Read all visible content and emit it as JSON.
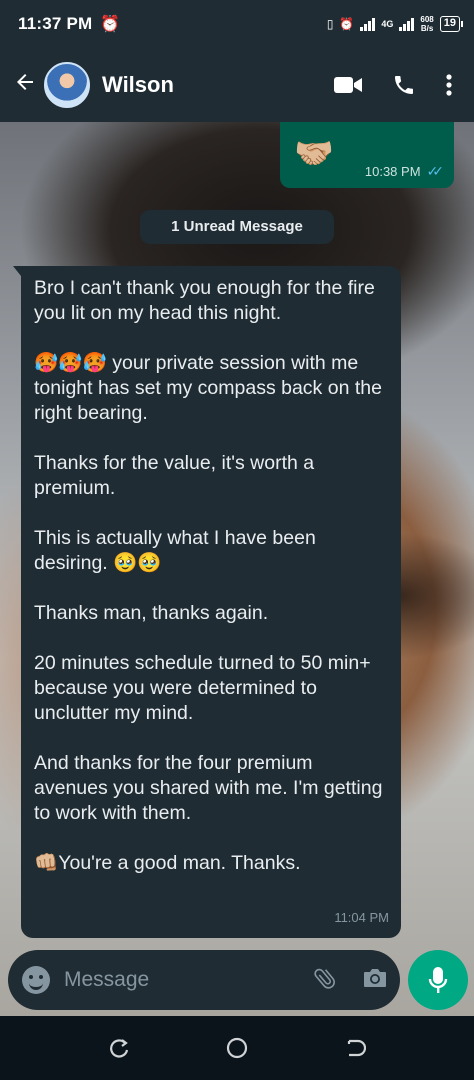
{
  "status_bar": {
    "time": "11:37 PM",
    "network_type": "4G",
    "net_rate_value": "608",
    "net_rate_unit": "B/s",
    "battery": "19"
  },
  "header": {
    "contact_name": "Wilson",
    "icons": [
      "back-arrow-icon",
      "video-call-icon",
      "phone-icon",
      "more-vert-icon"
    ]
  },
  "chat": {
    "outgoing": {
      "emoji": "🤝🏼",
      "time": "10:38 PM",
      "status": "read"
    },
    "unread_banner": "1 Unread Message",
    "incoming": {
      "paragraphs": [
        "Bro I can't thank you enough for the fire you lit on my head this night.",
        "🥵🥵🥵 your private session with me tonight has set my compass back on the right bearing.",
        "Thanks for the value, it's worth a premium.",
        "This is actually what I have been desiring. 🥹🥹",
        "Thanks man, thanks again.",
        "20 minutes schedule turned to 50 min+ because you were determined to unclutter my mind.",
        "And thanks for the four premium avenues you shared with me. I'm getting to work with them.",
        "👊🏼You're a good man. Thanks."
      ],
      "time": "11:04 PM"
    }
  },
  "composer": {
    "placeholder": "Message"
  },
  "colors": {
    "header_bg": "#1f2c34",
    "outgoing_bubble": "#005c4b",
    "incoming_bubble": "#1f2c34",
    "accent": "#00a884",
    "read_ticks": "#53bdeb"
  }
}
